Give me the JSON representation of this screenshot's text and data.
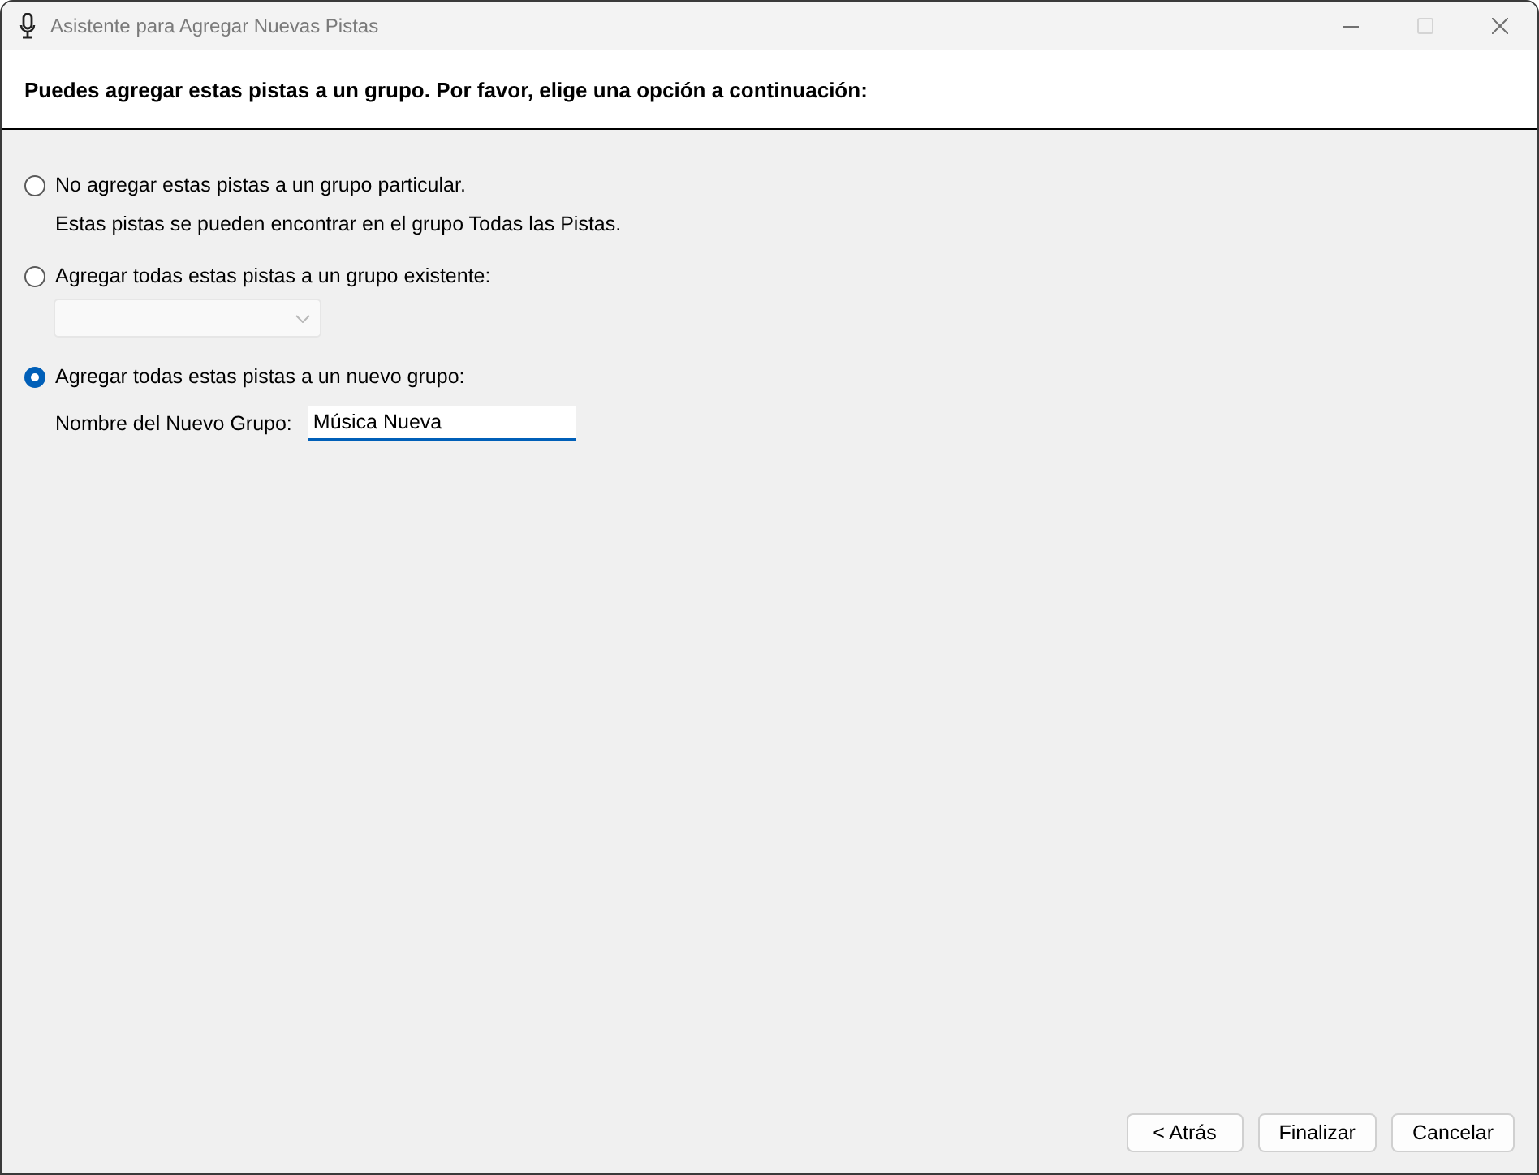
{
  "window": {
    "title": "Asistente para Agregar Nuevas Pistas",
    "controls": [
      {
        "kind": "minimize",
        "disabled": false
      },
      {
        "kind": "maximize",
        "disabled": true
      },
      {
        "kind": "close",
        "disabled": false
      }
    ]
  },
  "header": {
    "text": "Puedes agregar estas pistas a un grupo. Por favor, elige una opción a continuación:"
  },
  "options": [
    {
      "kind": "note",
      "label": "No agregar estas pistas a un grupo particular.",
      "selected": false,
      "note": "Estas pistas se pueden encontrar en el grupo Todas las Pistas."
    },
    {
      "kind": "dropdown",
      "label": "Agregar todas estas pistas a un grupo existente:",
      "selected": false,
      "dropdown": {
        "disabled": true
      }
    },
    {
      "kind": "text-field",
      "label": "Agregar todas estas pistas a un nuevo grupo:",
      "selected": true,
      "field": {
        "label": "Nombre del Nuevo Grupo:",
        "value": "Música Nueva",
        "focused": true
      }
    }
  ],
  "buttons": [
    {
      "label": "< Atrás"
    },
    {
      "label": "Finalizar"
    },
    {
      "label": "Cancelar"
    }
  ]
}
